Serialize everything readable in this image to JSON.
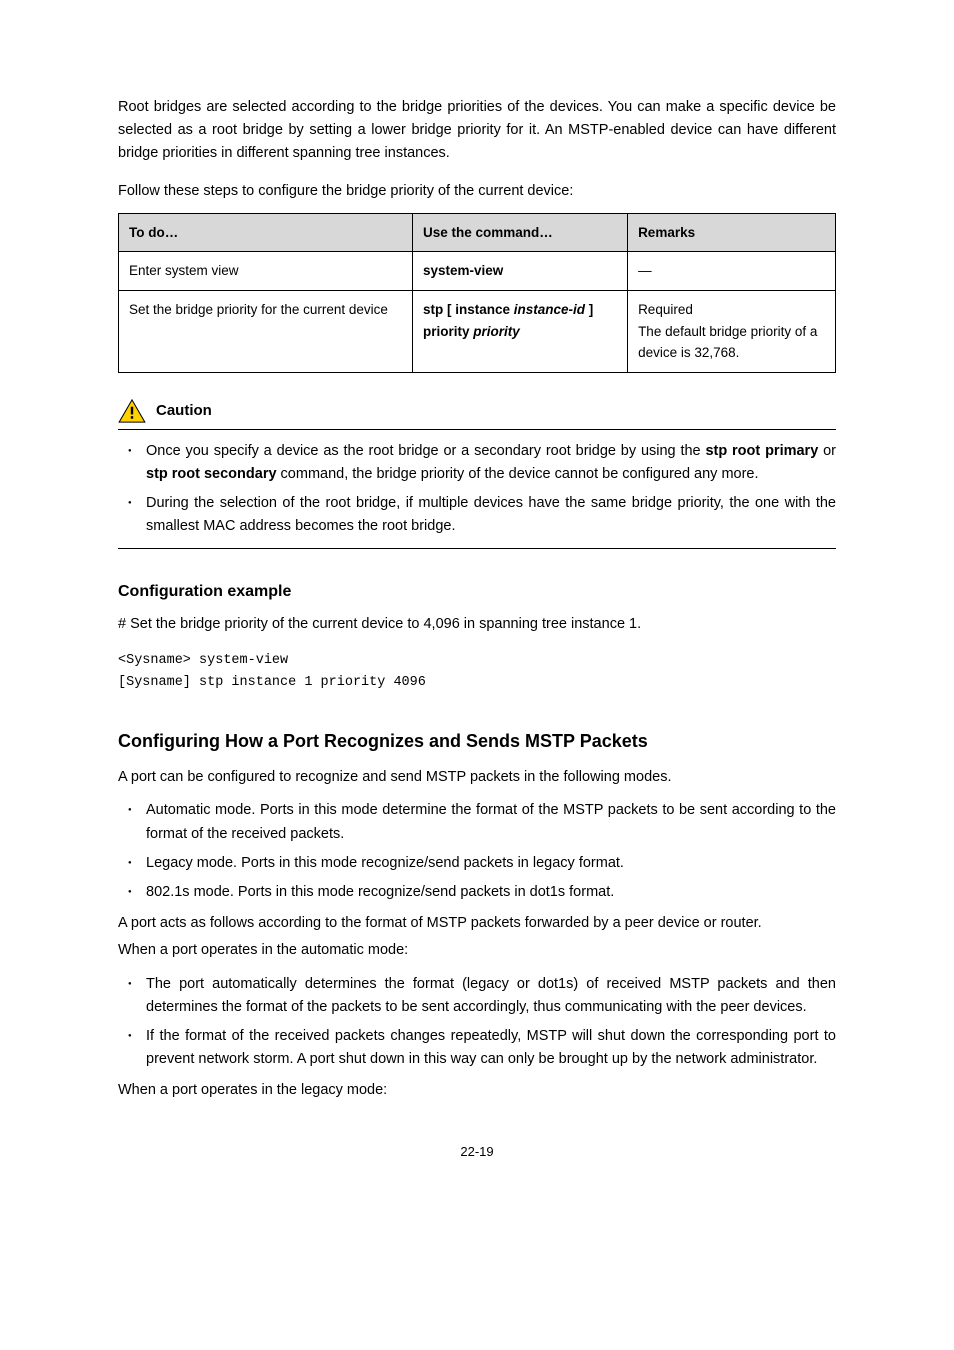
{
  "intro_p": "Root bridges are selected according to the bridge priorities of the devices. You can make a specific device be selected as a root bridge by setting a lower bridge priority for it. An MSTP-enabled device can have different bridge priorities in different spanning tree instances.",
  "table_caption": "Follow these steps to configure the bridge priority of the current device:",
  "table": {
    "head": {
      "c1": "To do…",
      "c2": "Use the command…",
      "c3": "Remarks"
    },
    "row1": {
      "c1": "Enter system view",
      "c2": "system-view",
      "c3": "—"
    },
    "row2": {
      "c1": "Set the bridge priority for the current device",
      "c2_a": "stp ",
      "c2_b": "[ ",
      "c2_c": "instance ",
      "c2_d": "instance-id ",
      "c2_e": "] ",
      "c2_f": "priority ",
      "c2_g": "priority",
      "c3a": "Required",
      "c3b": "The default bridge priority of a device is 32,768."
    }
  },
  "caution": {
    "label": "Caution",
    "b1_a": "Once you specify a device as the root bridge or a secondary root bridge by using the ",
    "b1_b": "stp root primary",
    "b1_c": " or ",
    "b1_d": "stp root secondary",
    "b1_e": " command, the bridge priority of the device cannot be configured any more.",
    "b2": "During the selection of the root bridge, if multiple devices have the same bridge priority, the one with the smallest MAC address becomes the root bridge."
  },
  "cfg_ex_heading": "Configuration example",
  "cfg_ex_line": "# Set the bridge priority of the current device to 4,096 in spanning tree instance 1.",
  "cli": "<Sysname> system-view\n[Sysname] stp instance 1 priority 4096",
  "h2": "Configuring How a Port Recognizes and Sends MSTP Packets",
  "modes_intro": "A port can be configured to recognize and send MSTP packets in the following modes.",
  "modes": {
    "m1": "Automatic mode. Ports in this mode determine the format of the MSTP packets to be sent according to the format of the received packets.",
    "m2": "Legacy mode. Ports in this mode recognize/send packets in legacy format.",
    "m3": "802.1s mode. Ports in this mode recognize/send packets in dot1s format."
  },
  "acts_line": "A port acts as follows according to the format of MSTP packets forwarded by a peer device or router.",
  "auto_label": "When a port operates in the automatic mode:",
  "auto": {
    "a1": "The port automatically determines the format (legacy or dot1s) of received MSTP packets and then determines the format of the packets to be sent accordingly, thus communicating with the peer devices.",
    "a2": "If the format of the received packets changes repeatedly, MSTP will shut down the corresponding port to prevent network storm. A port shut down in this way can only be brought up by the network administrator."
  },
  "legacy_label": "When a port operates in the legacy mode:",
  "page_number": "22-19"
}
